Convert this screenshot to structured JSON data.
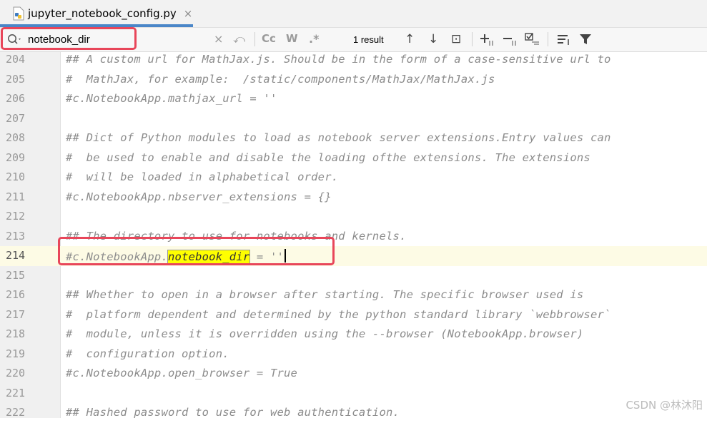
{
  "tab": {
    "filename": "jupyter_notebook_config.py",
    "close_glyph": "×",
    "icon": "python-file-icon"
  },
  "search": {
    "query": "notebook_dir",
    "result_count": "1 result",
    "buttons": {
      "clear": "×",
      "replace_history": "⤺",
      "match_case": "Cc",
      "words": "W",
      "regex": ".*",
      "prev": "↑",
      "next": "↓",
      "select_all": "⊡",
      "filter": "▼"
    }
  },
  "lines": [
    {
      "num": "204",
      "code": "## A custom url for MathJax.js. Should be in the form of a case-sensitive url to"
    },
    {
      "num": "205",
      "code": "#  MathJax, for example:  /static/components/MathJax/MathJax.js"
    },
    {
      "num": "206",
      "code": "#c.NotebookApp.mathjax_url = ''"
    },
    {
      "num": "207",
      "code": ""
    },
    {
      "num": "208",
      "code": "## Dict of Python modules to load as notebook server extensions.Entry values can"
    },
    {
      "num": "209",
      "code": "#  be used to enable and disable the loading ofthe extensions. The extensions"
    },
    {
      "num": "210",
      "code": "#  will be loaded in alphabetical order."
    },
    {
      "num": "211",
      "code": "#c.NotebookApp.nbserver_extensions = {}"
    },
    {
      "num": "212",
      "code": ""
    },
    {
      "num": "213",
      "code": "## The directory to use for notebooks and kernels."
    },
    {
      "num": "214",
      "code_before": "#c.NotebookApp.",
      "code_match": "notebook_dir",
      "code_after": " = ''"
    },
    {
      "num": "215",
      "code": ""
    },
    {
      "num": "216",
      "code": "## Whether to open in a browser after starting. The specific browser used is"
    },
    {
      "num": "217",
      "code": "#  platform dependent and determined by the python standard library `webbrowser`"
    },
    {
      "num": "218",
      "code": "#  module, unless it is overridden using the --browser (NotebookApp.browser)"
    },
    {
      "num": "219",
      "code": "#  configuration option."
    },
    {
      "num": "220",
      "code": "#c.NotebookApp.open_browser = True"
    },
    {
      "num": "221",
      "code": ""
    },
    {
      "num": "222",
      "code": "## Hashed password to use for web authentication."
    }
  ],
  "watermark": "CSDN @林沐阳",
  "colors": {
    "highlight_box": "#e8465a",
    "match_bg": "#ffff00",
    "tab_underline": "#4a86c8"
  }
}
